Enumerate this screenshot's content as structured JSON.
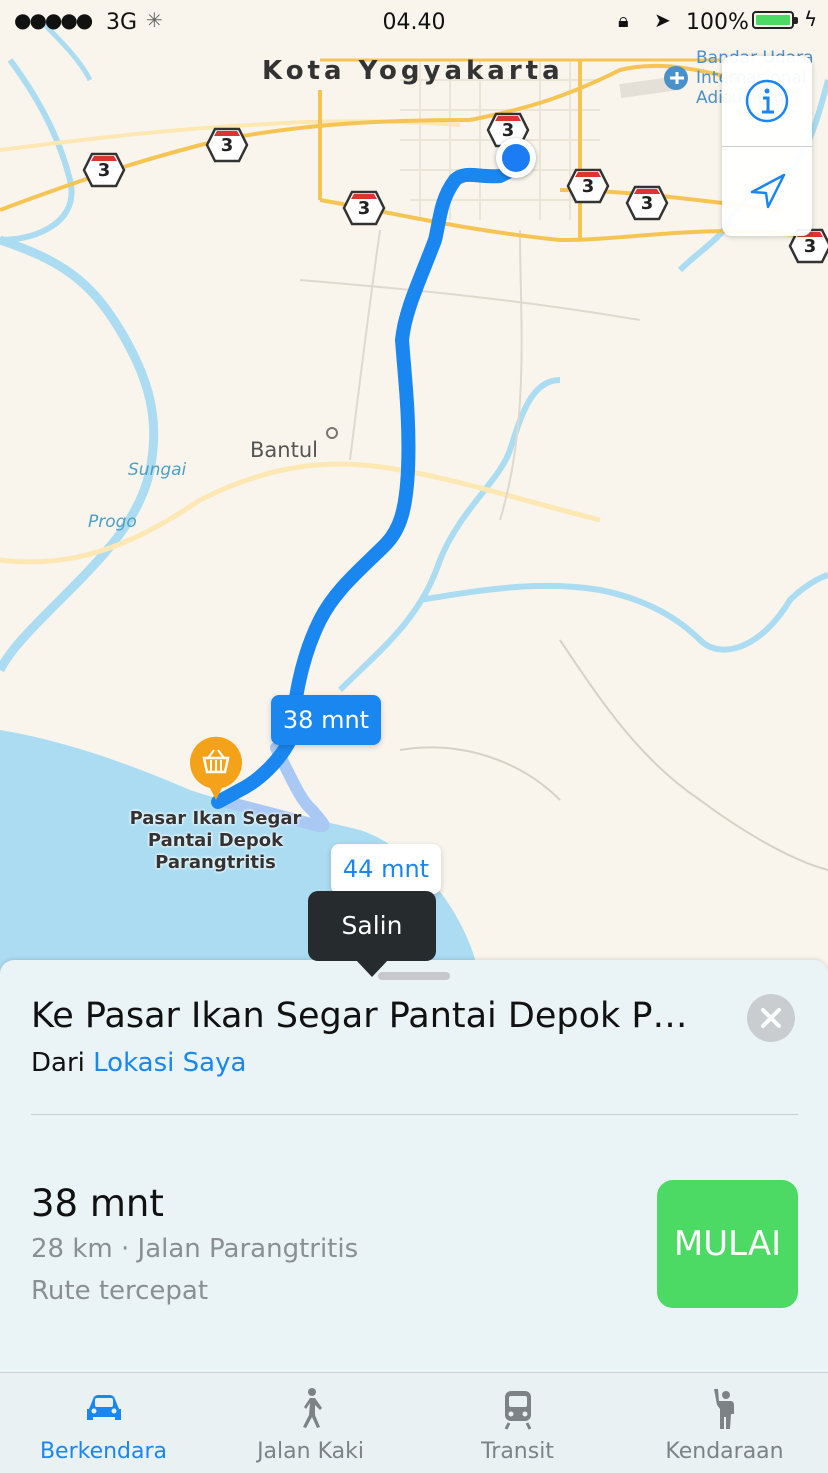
{
  "status_bar": {
    "signal": "●●●●●",
    "network": "3G",
    "time": "04.40",
    "battery_percent": "100%"
  },
  "map": {
    "city_label": "Kota Yogyakarta",
    "town_label": "Bantul",
    "river_label_1": "Sungai",
    "river_label_2": "Progo",
    "airport_label": "Bandar Udara\nInternasional\nAdisucipto",
    "destination_label": "Pasar Ikan Segar\nPantai Depok\nParangtritis",
    "highway_number": "3",
    "route_primary_time": "38 mnt",
    "route_alt_time": "44 mnt",
    "popover_text": "Salin"
  },
  "sheet": {
    "destination_title": "Ke Pasar Ikan Segar Pantai Depok P…",
    "from_prefix": "Dari",
    "from_link": "Lokasi Saya",
    "eta": "38 mnt",
    "route_details": "28 km · Jalan Parangtritis",
    "route_note": "Rute tercepat",
    "start_label": "MULAI"
  },
  "tabs": [
    {
      "label": "Berkendara",
      "icon": "car-icon",
      "active": true
    },
    {
      "label": "Jalan Kaki",
      "icon": "walk-icon",
      "active": false
    },
    {
      "label": "Transit",
      "icon": "train-icon",
      "active": false
    },
    {
      "label": "Kendaraan",
      "icon": "hail-icon",
      "active": false
    }
  ],
  "colors": {
    "route": "#1a86f0",
    "start_button": "#4cd964",
    "river": "#a7d9ee",
    "road": "#f6c453"
  }
}
